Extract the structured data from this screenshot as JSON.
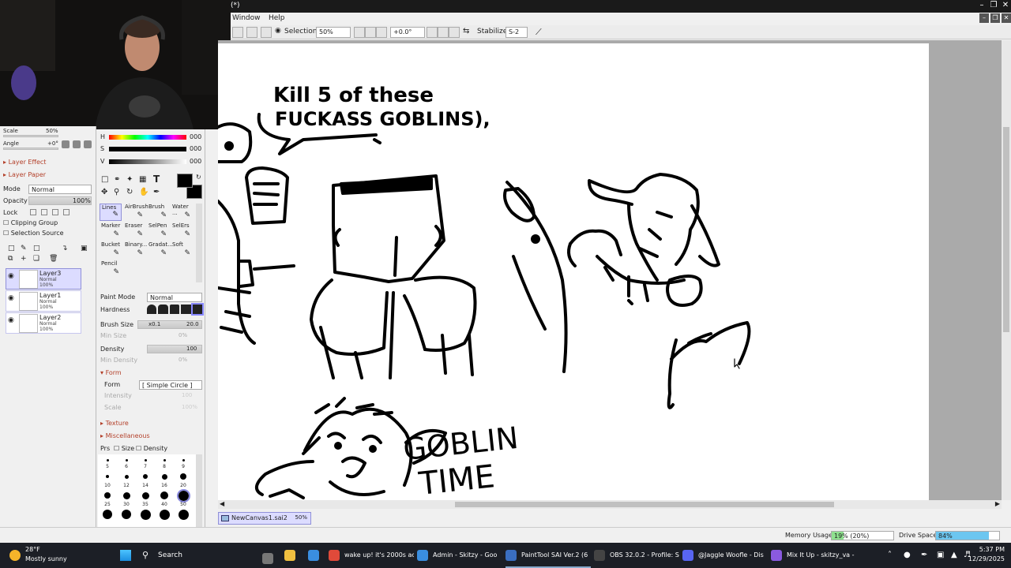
{
  "window": {
    "title_fragment": "(*)"
  },
  "menu": {
    "items": [
      "Window",
      "Help"
    ]
  },
  "toolbar": {
    "selection_label": "Selection",
    "zoom": "50%",
    "rotation": "+0.0°",
    "stabilizer_label": "Stabilizer",
    "stabilizer_value": "S-2"
  },
  "navigator": {
    "scale_label": "Scale",
    "scale_value": "50%",
    "angle_label": "Angle",
    "angle_value": "+0°"
  },
  "color": {
    "h_label": "H",
    "h_value": "000",
    "s_label": "S",
    "s_value": "000",
    "v_label": "V",
    "v_value": "000",
    "foreground": "#000000",
    "background": "#000000"
  },
  "layer_panel": {
    "layer_effect": "Layer Effect",
    "layer_paper": "Layer Paper",
    "mode_label": "Mode",
    "mode_value": "Normal",
    "opacity_label": "Opacity",
    "opacity_value": "100%",
    "lock_label": "Lock",
    "clipping_group": "Clipping Group",
    "selection_source": "Selection Source",
    "layers": [
      {
        "name": "Layer3",
        "mode": "Normal",
        "opacity": "100%"
      },
      {
        "name": "Layer1",
        "mode": "Normal",
        "opacity": "100%"
      },
      {
        "name": "Layer2",
        "mode": "Normal",
        "opacity": "100%"
      }
    ]
  },
  "tools": [
    {
      "name": "Lines",
      "icon": "pen-icon"
    },
    {
      "name": "AirBrush",
      "icon": "airbrush-icon"
    },
    {
      "name": "Brush",
      "icon": "brush-icon"
    },
    {
      "name": "Water ...",
      "icon": "water-icon"
    },
    {
      "name": "Marker",
      "icon": "marker-icon"
    },
    {
      "name": "Eraser",
      "icon": "eraser-icon"
    },
    {
      "name": "SelPen",
      "icon": "selpen-icon"
    },
    {
      "name": "SelErs",
      "icon": "selers-icon"
    },
    {
      "name": "Bucket",
      "icon": "bucket-icon"
    },
    {
      "name": "Binary...",
      "icon": "binary-icon"
    },
    {
      "name": "Gradat...",
      "icon": "gradient-icon"
    },
    {
      "name": "Soft",
      "icon": "soft-icon"
    },
    {
      "name": "Pencil",
      "icon": "pencil-icon"
    }
  ],
  "tool_options": {
    "paint_mode_label": "Paint Mode",
    "paint_mode_value": "Normal",
    "hardness_label": "Hardness",
    "brush_size_label": "Brush Size",
    "brush_size_mult": "x0.1",
    "brush_size_value": "20.0",
    "min_size_label": "Min Size",
    "min_size_value": "0%",
    "density_label": "Density",
    "density_value": "100",
    "min_density_label": "Min Density",
    "min_density_value": "0%",
    "form_section": "Form",
    "form_label": "Form",
    "form_value": "[ Simple Circle ]",
    "intensity_label": "Intensity",
    "intensity_value": "100",
    "scale_label": "Scale",
    "scale_value": "100%",
    "texture_section": "Texture",
    "misc_section": "Miscellaneous",
    "prs_label": "Prs",
    "size_label": "Size",
    "density_check_label": "Density"
  },
  "brush_sizes": [
    "5",
    "6",
    "7",
    "8",
    "9",
    "10",
    "12",
    "14",
    "16",
    "20",
    "25",
    "30",
    "35",
    "40",
    "50"
  ],
  "canvas": {
    "caption_line1": "Kill 5 of these",
    "caption_line2": "FUCKASS GOBLINS),",
    "goblin_time_1": "GOBLIN",
    "goblin_time_2": "TIME"
  },
  "document_tab": {
    "name": "NewCanvas1.sai2",
    "zoom": "50%"
  },
  "status": {
    "memory_label": "Memory Usage",
    "memory_value": "19% (20%)",
    "memory_fraction": 0.19,
    "drive_label": "Drive Space",
    "drive_value": "84%",
    "drive_fraction": 0.84
  },
  "taskbar": {
    "weather_temp": "28°F",
    "weather_desc": "Mostly sunny",
    "search_label": "Search",
    "apps": [
      {
        "label": "wake up! it's 2000s ac",
        "color": "#e04a3a"
      },
      {
        "label": "Admin - Skitzy - Goo",
        "color": "#3a8ee0"
      },
      {
        "label": "PaintTool SAI Ver.2 (6",
        "color": "#3a6ec0"
      },
      {
        "label": "OBS 32.0.2 - Profile: S",
        "color": "#444444"
      },
      {
        "label": "@Jaggle Woofle - Dis",
        "color": "#5865f2"
      },
      {
        "label": "Mix It Up - skitzy_va -",
        "color": "#8a5ae0"
      }
    ],
    "time": "5:37 PM",
    "date": "12/29/2025"
  }
}
